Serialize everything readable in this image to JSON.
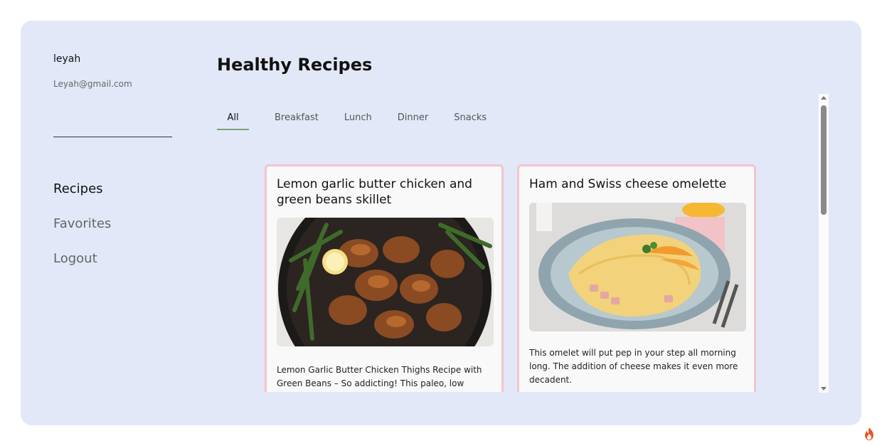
{
  "user": {
    "name": "leyah",
    "email": "Leyah@gmail.com"
  },
  "nav": {
    "items": [
      {
        "label": "Recipes",
        "active": true
      },
      {
        "label": "Favorites",
        "active": false
      },
      {
        "label": "Logout",
        "active": false
      }
    ]
  },
  "main": {
    "title": "Healthy Recipes",
    "tabs": [
      {
        "label": "All",
        "active": true
      },
      {
        "label": "Breakfast",
        "active": false
      },
      {
        "label": "Lunch",
        "active": false
      },
      {
        "label": "Dinner",
        "active": false
      },
      {
        "label": "Snacks",
        "active": false
      }
    ],
    "cards": [
      {
        "title": "Lemon garlic butter chicken and green beans skillet",
        "image_icon": "skillet-chicken-image",
        "description": "Lemon Garlic Butter Chicken Thighs Recipe with Green Beans – So addicting! This paleo, low"
      },
      {
        "title": "Ham and Swiss cheese omelette",
        "image_icon": "omelette-plate-image",
        "description": "This omelet will put pep in your step all morning long. The addition of cheese makes it even more decadent."
      }
    ]
  },
  "colors": {
    "panel_bg": "#e2e8f8",
    "card_border": "#f3c4cc",
    "tab_underline": "#7aa37a"
  },
  "icons": {
    "corner": "fire-icon"
  }
}
